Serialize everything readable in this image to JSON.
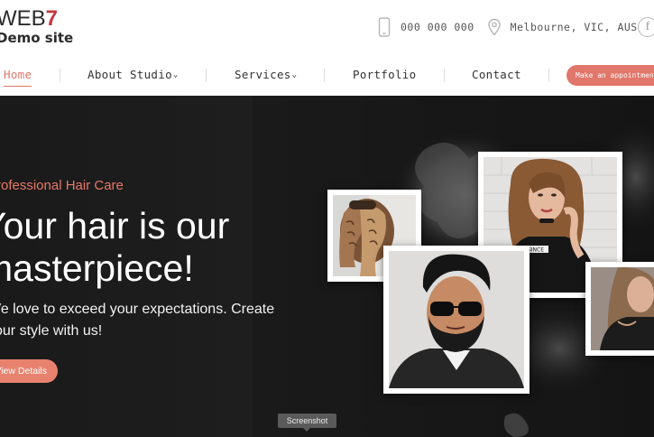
{
  "brand": {
    "logo_line1_text": "WEB",
    "logo_line1_number": "7",
    "logo_line2": "Demo site"
  },
  "contact": {
    "phone": "000 000 000",
    "location": "Melbourne, VIC, AUS",
    "facebook_glyph": "f"
  },
  "nav": {
    "items": [
      {
        "label": "Home",
        "active": true
      },
      {
        "label": "About Studio",
        "dropdown": true
      },
      {
        "label": "Services",
        "dropdown": true
      },
      {
        "label": "Portfolio"
      },
      {
        "label": "Contact"
      }
    ],
    "cta_label": "Make an appointment"
  },
  "hero": {
    "kicker": "Professional Hair Care",
    "headline_line1": "Your hair is our",
    "headline_line2": "masterpiece!",
    "lead_line1": "We love to exceed your expectations. Create",
    "lead_line2": "your style with us!",
    "button_label": "View Details",
    "photos": [
      {
        "subject": "woman with braided hair, back view"
      },
      {
        "subject": "woman in black t-shirt with choker"
      },
      {
        "subject": "bearded man with sunglasses"
      },
      {
        "subject": "woman with long hair, partial view"
      }
    ],
    "shirt_text": "SINCE"
  },
  "tooltip": "Screenshot",
  "colors": {
    "accent": "#e1766a",
    "hero_bg": "#1a1a1a",
    "logo_red": "#c8373b"
  }
}
